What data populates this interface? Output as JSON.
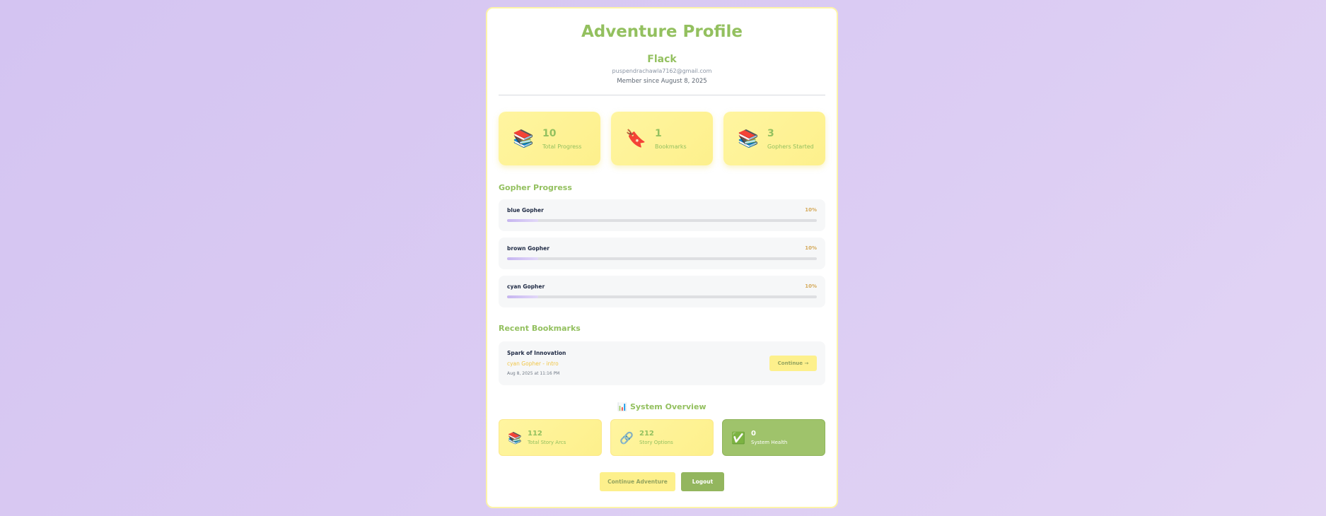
{
  "profile": {
    "title": "Adventure Profile",
    "username": "Flack",
    "email": "puspendrachawla7162@gmail.com",
    "member_since": "Member since August 8, 2025"
  },
  "stats": [
    {
      "icon": "books-icon",
      "glyph": "📚",
      "value": "10",
      "label": "Total Progress"
    },
    {
      "icon": "bookmark-icon",
      "glyph": "🔖",
      "value": "1",
      "label": "Bookmarks"
    },
    {
      "icon": "books-icon",
      "glyph": "📚",
      "value": "3",
      "label": "Gophers Started"
    }
  ],
  "gopher_progress": {
    "heading": "Gopher Progress",
    "items": [
      {
        "name": "blue Gopher",
        "percent_label": "10%",
        "percent": 10
      },
      {
        "name": "brown Gopher",
        "percent_label": "10%",
        "percent": 10
      },
      {
        "name": "cyan Gopher",
        "percent_label": "10%",
        "percent": 10
      }
    ]
  },
  "recent_bookmarks": {
    "heading": "Recent Bookmarks",
    "items": [
      {
        "title": "Spark of Innovation",
        "subtitle": "cyan Gopher - intro",
        "date": "Aug 8, 2025 at 11:16 PM",
        "button": "Continue →"
      }
    ]
  },
  "system_overview": {
    "heading": "📊 System Overview",
    "items": [
      {
        "icon": "books-icon",
        "glyph": "📚",
        "value": "112",
        "label": "Total Story Arcs"
      },
      {
        "icon": "link-icon",
        "glyph": "🔗",
        "value": "212",
        "label": "Story Options"
      },
      {
        "icon": "check-icon",
        "glyph": "✅",
        "value": "0",
        "label": "System Health"
      }
    ]
  },
  "actions": {
    "continue": "Continue Adventure",
    "logout": "Logout"
  },
  "colors": {
    "accent_green": "#93c05f",
    "accent_yellow": "#fdf08c",
    "background": "#d4c4f2"
  }
}
